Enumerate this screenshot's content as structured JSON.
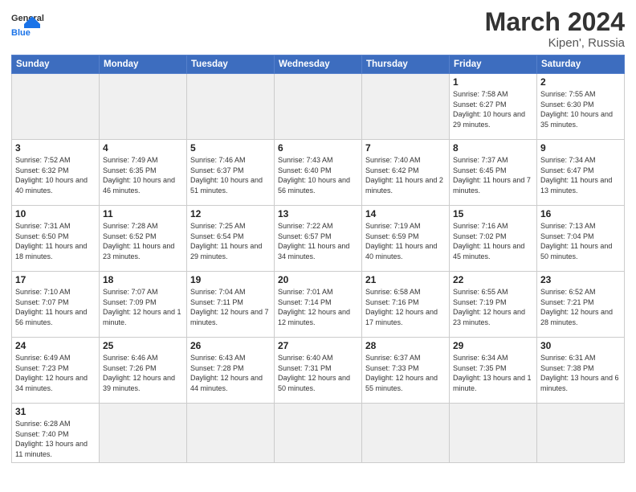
{
  "header": {
    "logo_general": "General",
    "logo_blue": "Blue",
    "title": "March 2024",
    "location": "Kipen', Russia"
  },
  "weekdays": [
    "Sunday",
    "Monday",
    "Tuesday",
    "Wednesday",
    "Thursday",
    "Friday",
    "Saturday"
  ],
  "weeks": [
    [
      {
        "day": "",
        "info": "",
        "empty": true
      },
      {
        "day": "",
        "info": "",
        "empty": true
      },
      {
        "day": "",
        "info": "",
        "empty": true
      },
      {
        "day": "",
        "info": "",
        "empty": true
      },
      {
        "day": "",
        "info": "",
        "empty": true
      },
      {
        "day": "1",
        "info": "Sunrise: 7:58 AM\nSunset: 6:27 PM\nDaylight: 10 hours and 29 minutes."
      },
      {
        "day": "2",
        "info": "Sunrise: 7:55 AM\nSunset: 6:30 PM\nDaylight: 10 hours and 35 minutes."
      }
    ],
    [
      {
        "day": "3",
        "info": "Sunrise: 7:52 AM\nSunset: 6:32 PM\nDaylight: 10 hours and 40 minutes."
      },
      {
        "day": "4",
        "info": "Sunrise: 7:49 AM\nSunset: 6:35 PM\nDaylight: 10 hours and 46 minutes."
      },
      {
        "day": "5",
        "info": "Sunrise: 7:46 AM\nSunset: 6:37 PM\nDaylight: 10 hours and 51 minutes."
      },
      {
        "day": "6",
        "info": "Sunrise: 7:43 AM\nSunset: 6:40 PM\nDaylight: 10 hours and 56 minutes."
      },
      {
        "day": "7",
        "info": "Sunrise: 7:40 AM\nSunset: 6:42 PM\nDaylight: 11 hours and 2 minutes."
      },
      {
        "day": "8",
        "info": "Sunrise: 7:37 AM\nSunset: 6:45 PM\nDaylight: 11 hours and 7 minutes."
      },
      {
        "day": "9",
        "info": "Sunrise: 7:34 AM\nSunset: 6:47 PM\nDaylight: 11 hours and 13 minutes."
      }
    ],
    [
      {
        "day": "10",
        "info": "Sunrise: 7:31 AM\nSunset: 6:50 PM\nDaylight: 11 hours and 18 minutes."
      },
      {
        "day": "11",
        "info": "Sunrise: 7:28 AM\nSunset: 6:52 PM\nDaylight: 11 hours and 23 minutes."
      },
      {
        "day": "12",
        "info": "Sunrise: 7:25 AM\nSunset: 6:54 PM\nDaylight: 11 hours and 29 minutes."
      },
      {
        "day": "13",
        "info": "Sunrise: 7:22 AM\nSunset: 6:57 PM\nDaylight: 11 hours and 34 minutes."
      },
      {
        "day": "14",
        "info": "Sunrise: 7:19 AM\nSunset: 6:59 PM\nDaylight: 11 hours and 40 minutes."
      },
      {
        "day": "15",
        "info": "Sunrise: 7:16 AM\nSunset: 7:02 PM\nDaylight: 11 hours and 45 minutes."
      },
      {
        "day": "16",
        "info": "Sunrise: 7:13 AM\nSunset: 7:04 PM\nDaylight: 11 hours and 50 minutes."
      }
    ],
    [
      {
        "day": "17",
        "info": "Sunrise: 7:10 AM\nSunset: 7:07 PM\nDaylight: 11 hours and 56 minutes."
      },
      {
        "day": "18",
        "info": "Sunrise: 7:07 AM\nSunset: 7:09 PM\nDaylight: 12 hours and 1 minute."
      },
      {
        "day": "19",
        "info": "Sunrise: 7:04 AM\nSunset: 7:11 PM\nDaylight: 12 hours and 7 minutes."
      },
      {
        "day": "20",
        "info": "Sunrise: 7:01 AM\nSunset: 7:14 PM\nDaylight: 12 hours and 12 minutes."
      },
      {
        "day": "21",
        "info": "Sunrise: 6:58 AM\nSunset: 7:16 PM\nDaylight: 12 hours and 17 minutes."
      },
      {
        "day": "22",
        "info": "Sunrise: 6:55 AM\nSunset: 7:19 PM\nDaylight: 12 hours and 23 minutes."
      },
      {
        "day": "23",
        "info": "Sunrise: 6:52 AM\nSunset: 7:21 PM\nDaylight: 12 hours and 28 minutes."
      }
    ],
    [
      {
        "day": "24",
        "info": "Sunrise: 6:49 AM\nSunset: 7:23 PM\nDaylight: 12 hours and 34 minutes."
      },
      {
        "day": "25",
        "info": "Sunrise: 6:46 AM\nSunset: 7:26 PM\nDaylight: 12 hours and 39 minutes."
      },
      {
        "day": "26",
        "info": "Sunrise: 6:43 AM\nSunset: 7:28 PM\nDaylight: 12 hours and 44 minutes."
      },
      {
        "day": "27",
        "info": "Sunrise: 6:40 AM\nSunset: 7:31 PM\nDaylight: 12 hours and 50 minutes."
      },
      {
        "day": "28",
        "info": "Sunrise: 6:37 AM\nSunset: 7:33 PM\nDaylight: 12 hours and 55 minutes."
      },
      {
        "day": "29",
        "info": "Sunrise: 6:34 AM\nSunset: 7:35 PM\nDaylight: 13 hours and 1 minute."
      },
      {
        "day": "30",
        "info": "Sunrise: 6:31 AM\nSunset: 7:38 PM\nDaylight: 13 hours and 6 minutes."
      }
    ],
    [
      {
        "day": "31",
        "info": "Sunrise: 6:28 AM\nSunset: 7:40 PM\nDaylight: 13 hours and 11 minutes."
      },
      {
        "day": "",
        "info": "",
        "empty": true
      },
      {
        "day": "",
        "info": "",
        "empty": true
      },
      {
        "day": "",
        "info": "",
        "empty": true
      },
      {
        "day": "",
        "info": "",
        "empty": true
      },
      {
        "day": "",
        "info": "",
        "empty": true
      },
      {
        "day": "",
        "info": "",
        "empty": true
      }
    ]
  ]
}
